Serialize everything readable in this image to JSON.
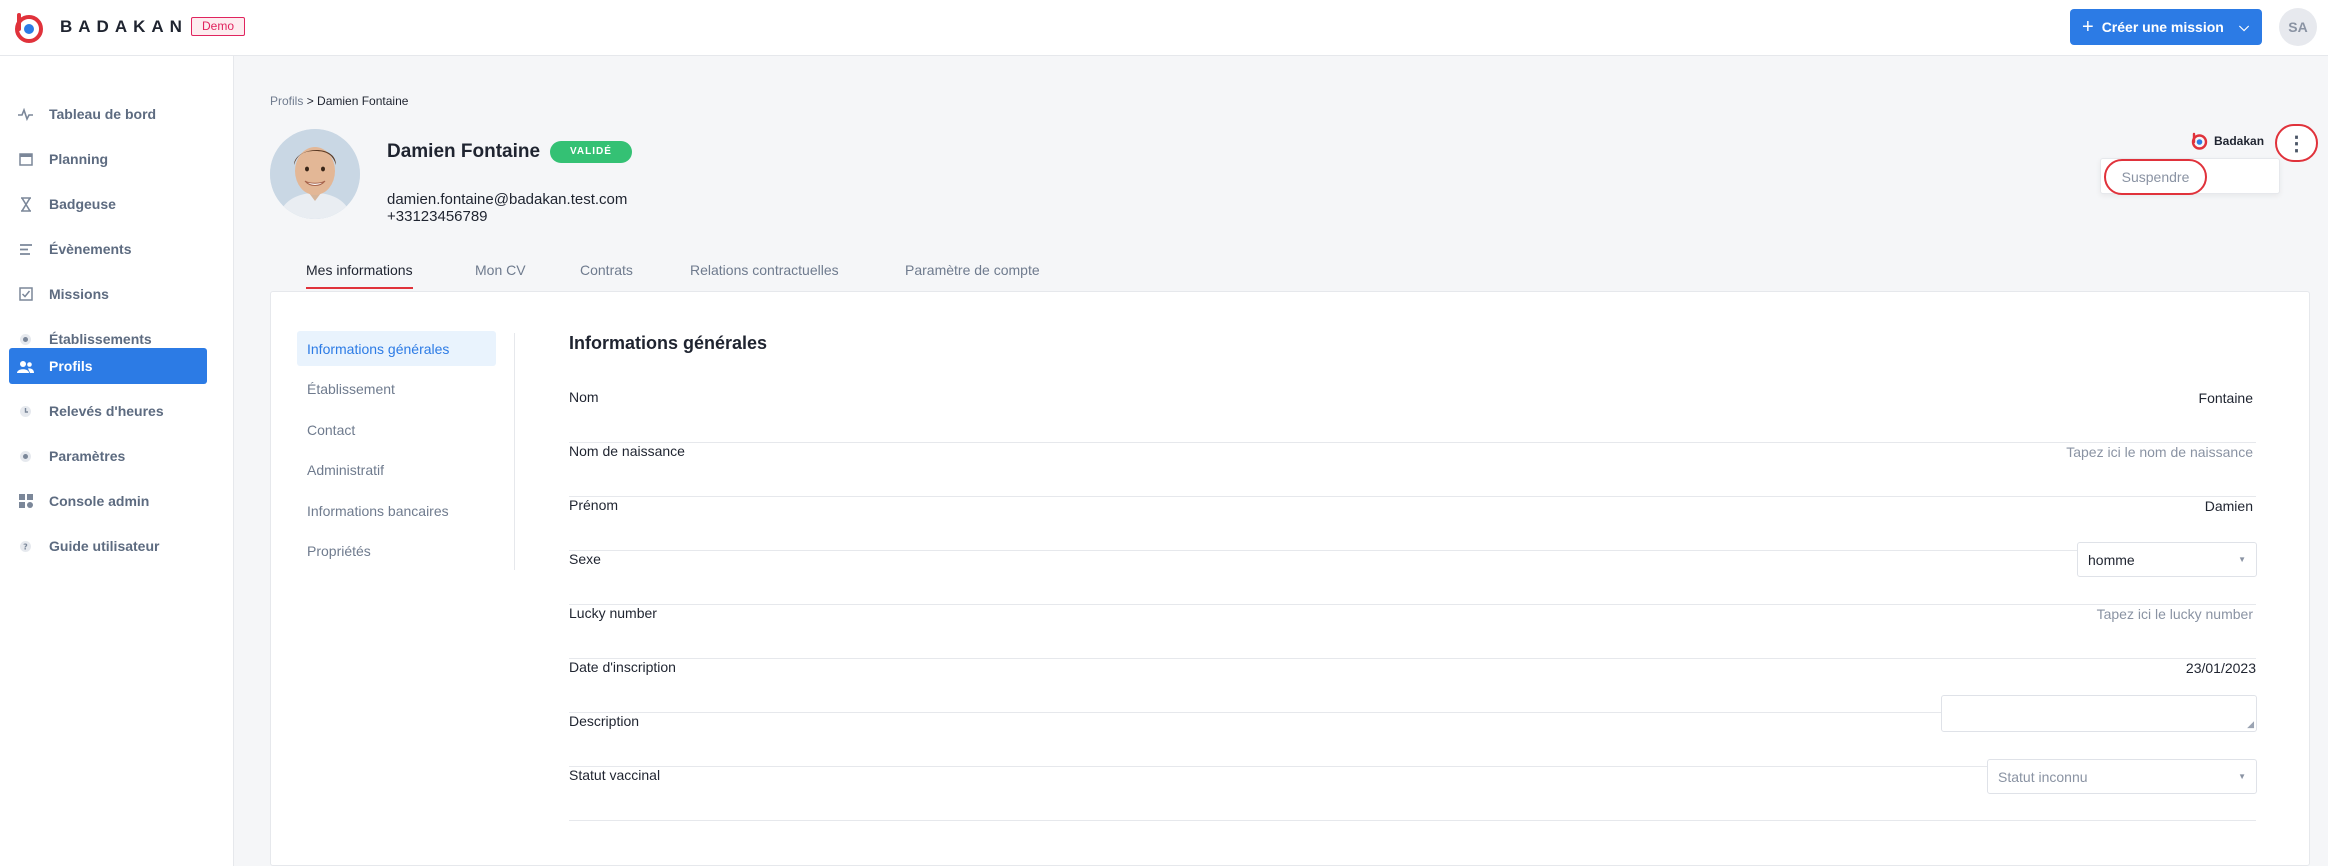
{
  "header": {
    "brand": "BADAKAN",
    "env_badge": "Demo",
    "create_button": "Créer une mission",
    "user_initials": "SA"
  },
  "sidebar": {
    "items": [
      {
        "label": "Tableau de bord",
        "icon": "pulse-icon",
        "active": false
      },
      {
        "label": "Planning",
        "icon": "calendar-icon",
        "active": false
      },
      {
        "label": "Badgeuse",
        "icon": "hourglass-icon",
        "active": false
      },
      {
        "label": "Évènements",
        "icon": "list-icon",
        "active": false
      },
      {
        "label": "Missions",
        "icon": "checkbox-icon",
        "active": false
      },
      {
        "label": "Établissements",
        "icon": "location-icon",
        "active": false
      },
      {
        "label": "Profils",
        "icon": "users-icon",
        "active": true
      },
      {
        "label": "Relevés d'heures",
        "icon": "clock-icon",
        "active": false
      },
      {
        "label": "Paramètres",
        "icon": "gear-icon",
        "active": false
      },
      {
        "label": "Console admin",
        "icon": "apps-icon",
        "active": false
      },
      {
        "label": "Guide utilisateur",
        "icon": "help-icon",
        "active": false
      }
    ]
  },
  "breadcrumb": {
    "parent": "Profils",
    "separator": ">",
    "current": "Damien Fontaine"
  },
  "profile": {
    "name": "Damien Fontaine",
    "status": "VALIDÉ",
    "email": "damien.fontaine@badakan.test.com",
    "phone": "+33123456789",
    "organization": "Badakan",
    "menu_item": "Suspendre"
  },
  "tabs": [
    {
      "label": "Mes informations",
      "active": true
    },
    {
      "label": "Mon CV",
      "active": false
    },
    {
      "label": "Contrats",
      "active": false
    },
    {
      "label": "Relations contractuelles",
      "active": false
    },
    {
      "label": "Paramètre de compte",
      "active": false
    }
  ],
  "subnav": [
    {
      "label": "Informations générales",
      "active": true
    },
    {
      "label": "Établissement",
      "active": false
    },
    {
      "label": "Contact",
      "active": false
    },
    {
      "label": "Administratif",
      "active": false
    },
    {
      "label": "Informations bancaires",
      "active": false
    },
    {
      "label": "Propriétés",
      "active": false
    }
  ],
  "section": {
    "title": "Informations générales",
    "fields": {
      "nom": {
        "label": "Nom",
        "value": "Fontaine"
      },
      "nom_naissance": {
        "label": "Nom de naissance",
        "placeholder": "Tapez ici le nom de naissance"
      },
      "prenom": {
        "label": "Prénom",
        "value": "Damien"
      },
      "sexe": {
        "label": "Sexe",
        "value": "homme"
      },
      "lucky": {
        "label": "Lucky number",
        "placeholder": "Tapez ici le lucky number"
      },
      "inscription": {
        "label": "Date d'inscription",
        "value": "23/01/2023"
      },
      "description": {
        "label": "Description",
        "value": ""
      },
      "vaccinal": {
        "label": "Statut vaccinal",
        "placeholder": "Statut inconnu"
      }
    }
  },
  "colors": {
    "primary": "#2c7be5",
    "brand_red": "#e0323b",
    "success": "#34c174"
  }
}
